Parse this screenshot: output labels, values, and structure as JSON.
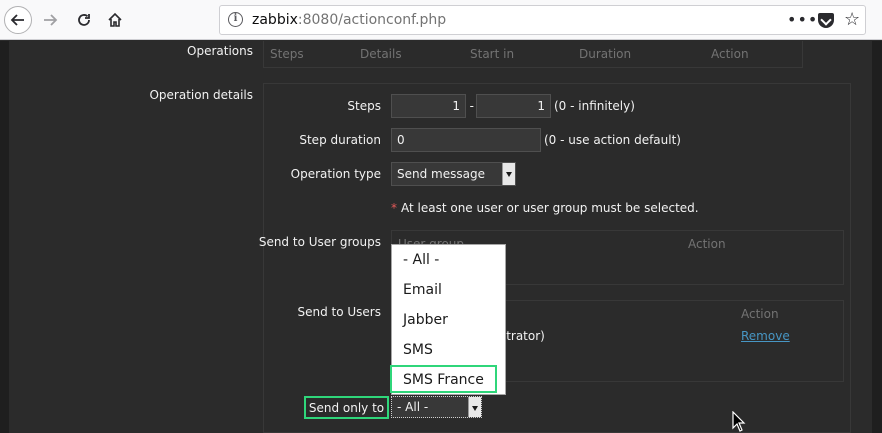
{
  "browser": {
    "url_host": "zabbix",
    "url_rest": ":8080/actionconf.php",
    "more_label": "•••"
  },
  "operations": {
    "label": "Operations",
    "headers": [
      "Steps",
      "Details",
      "Start in",
      "Duration",
      "Action"
    ]
  },
  "details": {
    "label": "Operation details",
    "steps_label": "Steps",
    "steps_from": "1",
    "steps_sep": "-",
    "steps_to": "1",
    "steps_hint": "(0 - infinitely)",
    "step_duration_label": "Step duration",
    "step_duration_value": "0",
    "step_duration_hint": "(0 - use action default)",
    "operation_type_label": "Operation type",
    "operation_type_value": "Send message",
    "required_star": "*",
    "required_text": "At least one user or user group must be selected.",
    "user_groups_label": "Send to User groups",
    "user_groups_col": "User group",
    "user_groups_action_col": "Action",
    "users_label": "Send to Users",
    "users_action_col": "Action",
    "user_row_text": "nistrator)",
    "user_row_action": "Remove",
    "send_only_to_label": "Send only to",
    "send_only_to_value": "- All -"
  },
  "dropdown": {
    "options": [
      "- All -",
      "Email",
      "Jabber",
      "SMS",
      "SMS France"
    ],
    "highlighted": "SMS France"
  },
  "colors": {
    "accent_green": "#2fd67a",
    "link": "#4796c4",
    "required": "#e45959"
  }
}
